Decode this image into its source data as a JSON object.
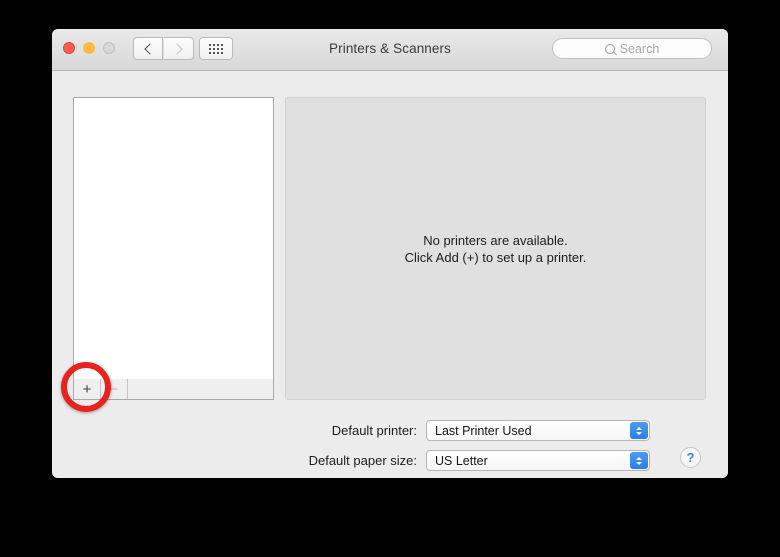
{
  "window": {
    "title": "Printers & Scanners",
    "traffic_lights": [
      {
        "name": "close",
        "color": "#fc5c54"
      },
      {
        "name": "minimize",
        "color": "#fdbc40"
      },
      {
        "name": "zoom",
        "color": "#d8d8d8"
      }
    ]
  },
  "toolbar": {
    "back_icon": "chevron-left-icon",
    "forward_icon": "chevron-right-icon",
    "grid_icon": "show-all-grid-icon",
    "search": {
      "icon": "search-icon",
      "placeholder": "Search",
      "value": ""
    }
  },
  "printer_list": {
    "items": [],
    "add_label": "+",
    "remove_label": "−"
  },
  "detail": {
    "empty_line1": "No printers are available.",
    "empty_line2": "Click Add (+) to set up a printer."
  },
  "settings": {
    "default_printer": {
      "label": "Default printer:",
      "value": "Last Printer Used"
    },
    "default_paper_size": {
      "label": "Default paper size:",
      "value": "US Letter"
    }
  },
  "help": {
    "label": "?"
  },
  "annotation": {
    "target": "add-printer-button",
    "color": "#e8231f"
  }
}
